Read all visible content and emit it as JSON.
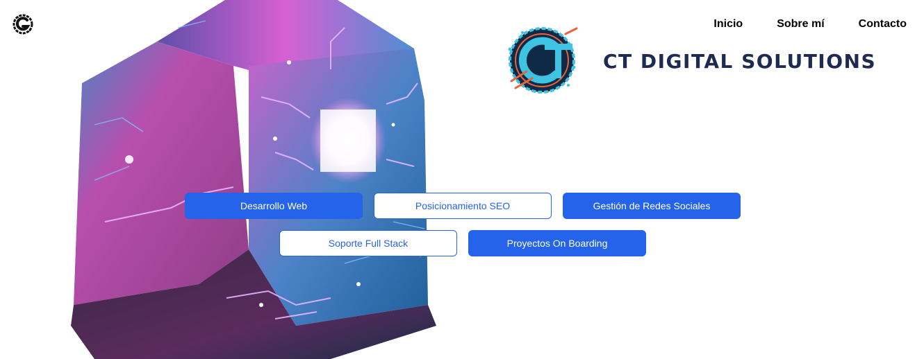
{
  "nav": {
    "items": [
      {
        "label": "Inicio"
      },
      {
        "label": "Sobre mí"
      },
      {
        "label": "Contacto"
      }
    ]
  },
  "brand": {
    "name": "CT DIGITAL SOLUTIONS",
    "emblem_letters": "CT"
  },
  "services": {
    "buttons": [
      {
        "label": "Desarrollo Web",
        "style": "solid"
      },
      {
        "label": "Posicionamiento SEO",
        "style": "outline"
      },
      {
        "label": "Gestión de Redes Sociales",
        "style": "solid"
      },
      {
        "label": "Soporte Full Stack",
        "style": "outline"
      },
      {
        "label": "Proyectos On Boarding",
        "style": "solid"
      }
    ]
  },
  "icons": {
    "corner_logo": "g-logo-icon",
    "hero": "circuit-cube-image",
    "brand_emblem": "ct-emblem-icon"
  },
  "colors": {
    "accent": "#2563eb",
    "brand_text": "#1d2a52",
    "cube_pink": "#d04fc9",
    "cube_blue": "#2e8fd0",
    "emblem_cyan": "#3ec3e3",
    "emblem_orange": "#e8643a"
  }
}
